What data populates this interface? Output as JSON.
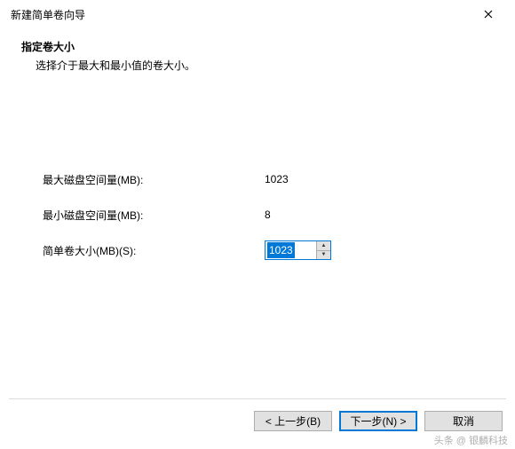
{
  "window": {
    "title": "新建简单卷向导"
  },
  "header": {
    "heading": "指定卷大小",
    "subheading": "选择介于最大和最小值的卷大小。"
  },
  "fields": {
    "max_label": "最大磁盘空间量(MB):",
    "max_value": "1023",
    "min_label": "最小磁盘空间量(MB):",
    "min_value": "8",
    "size_label": "简单卷大小(MB)(S):",
    "size_value": "1023"
  },
  "buttons": {
    "back": "< 上一步(B)",
    "next": "下一步(N) >",
    "cancel": "取消"
  },
  "watermark": "头条 @ 银麟科技"
}
